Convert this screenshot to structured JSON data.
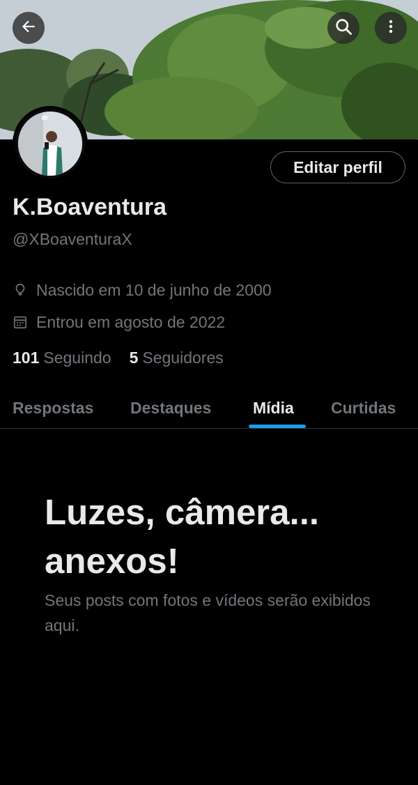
{
  "header": {
    "back_icon": "arrow-left-icon",
    "search_icon": "search-icon",
    "more_icon": "more-vertical-icon"
  },
  "profile": {
    "display_name": "K.Boaventura",
    "handle": "@XBoaventuraX",
    "edit_button_label": "Editar perfil",
    "birth_text": "Nascido em 10 de junho de 2000",
    "birth_icon": "balloon-icon",
    "joined_text": "Entrou em agosto de 2022",
    "joined_icon": "calendar-icon",
    "following_count": "101",
    "following_label": "Seguindo",
    "followers_count": "5",
    "followers_label": "Seguidores"
  },
  "tabs": [
    {
      "label": "Respostas",
      "active": false
    },
    {
      "label": "Destaques",
      "active": false
    },
    {
      "label": "Mídia",
      "active": true
    },
    {
      "label": "Curtidas",
      "active": false
    }
  ],
  "empty_state": {
    "title": "Luzes, câmera... anexos!",
    "subtitle": "Seus posts com fotos e vídeos serão exibidos aqui."
  },
  "colors": {
    "background": "#000000",
    "text_primary": "#e7e9ea",
    "text_secondary": "#71767b",
    "accent": "#1d9bf0",
    "border": "#2f3336"
  }
}
